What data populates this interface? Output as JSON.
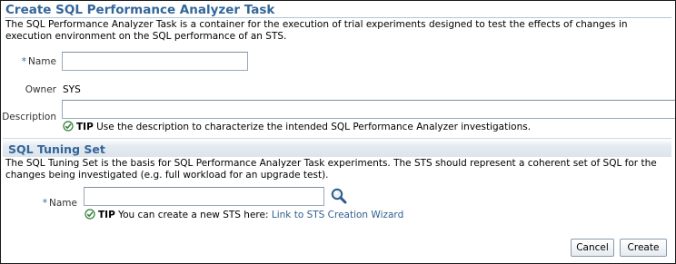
{
  "page": {
    "title": "Create SQL Performance Analyzer Task",
    "description": "The SQL Performance Analyzer Task is a container for the execution of trial experiments designed to test the effects of changes in execution environment on the SQL performance of an STS."
  },
  "task_form": {
    "required_marker": "*",
    "name_label": "Name",
    "name_value": "",
    "owner_label": "Owner",
    "owner_value": "SYS",
    "description_label": "Description",
    "description_value": "",
    "tip_label": "TIP",
    "tip_text": "Use the description to characterize the intended SQL Performance Analyzer investigations."
  },
  "sts_section": {
    "title": "SQL Tuning Set",
    "description": "The SQL Tuning Set is the basis for SQL Performance Analyzer Task experiments. The STS should represent a coherent set of SQL for the changes being investigated (e.g. full workload for an upgrade test).",
    "required_marker": "*",
    "name_label": "Name",
    "name_value": "",
    "tip_label": "TIP",
    "tip_text": "You can create a new STS here:",
    "link_text": "Link to STS Creation Wizard"
  },
  "buttons": {
    "cancel": "Cancel",
    "create": "Create"
  },
  "icons": {
    "search": "search-icon",
    "tip": "check-circle-icon"
  },
  "colors": {
    "heading": "#336699",
    "link": "#2f5f8f",
    "tip_check": "#2e7d32"
  }
}
